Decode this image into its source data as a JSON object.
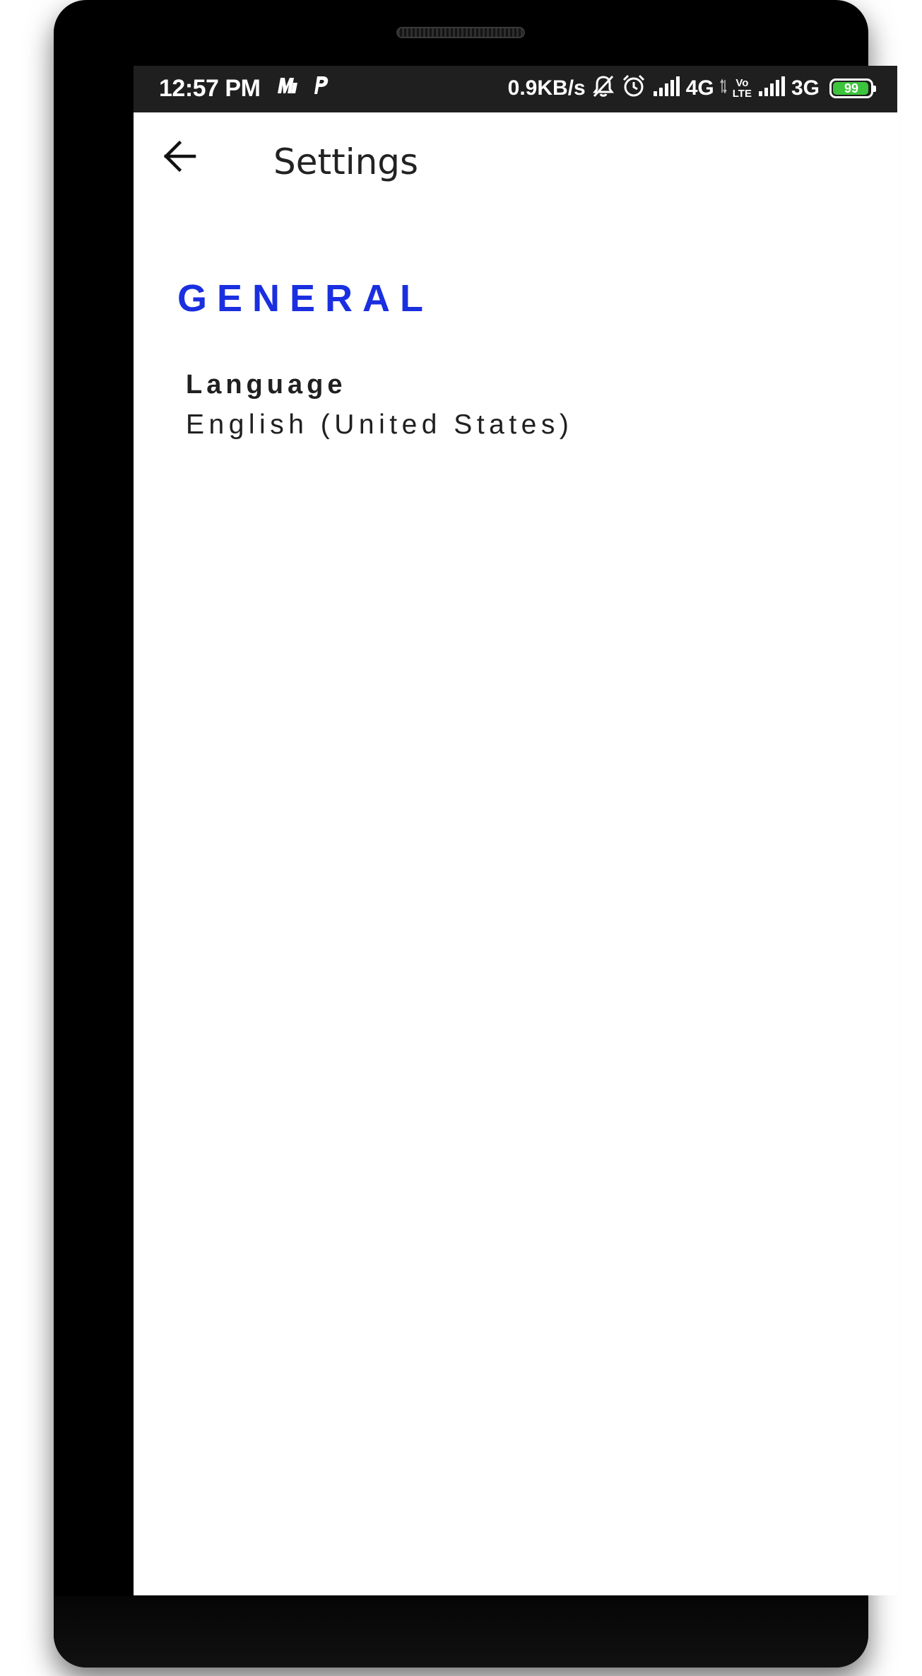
{
  "status_bar": {
    "time": "12:57 PM",
    "data_speed": "0.9KB/s",
    "network_1": "4G",
    "volte_top": "Vo",
    "volte_bottom": "LTE",
    "network_2": "3G",
    "battery_level": "99",
    "battery_fraction": 0.99,
    "battery_color": "#3cc43c",
    "left_icons": [
      "myjio-icon",
      "paytm-icon"
    ],
    "right_icons": [
      "mute-icon",
      "alarm-icon",
      "signal-icon",
      "signal-icon",
      "battery-icon"
    ]
  },
  "app_bar": {
    "title": "Settings",
    "back_icon": "arrow-left-icon"
  },
  "general": {
    "header": "GENERAL",
    "accent_color": "#1a2fe0",
    "items": [
      {
        "title": "Language",
        "summary": "English (United States)"
      }
    ]
  }
}
